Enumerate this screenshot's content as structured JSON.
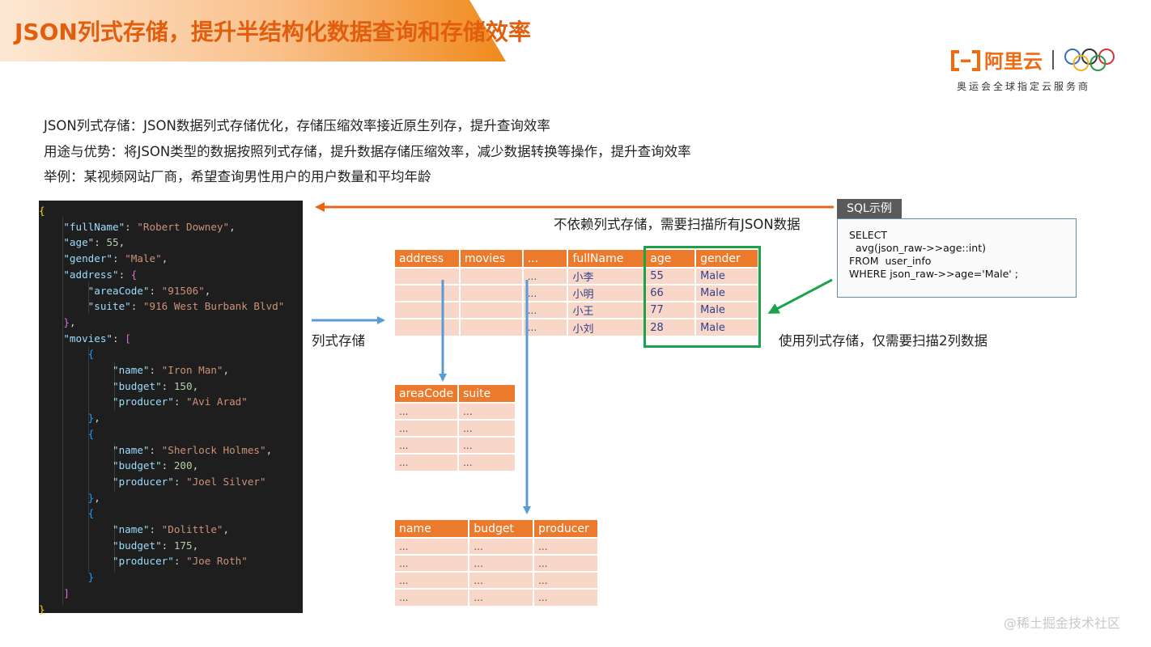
{
  "title": "JSON列式存储，提升半结构化数据查询和存储效率",
  "logo": {
    "brand": "阿里云",
    "subtitle": "奥运会全球指定云服务商",
    "brand_color": "#f26a10"
  },
  "description": [
    "JSON列式存储：JSON数据列式存储优化，存储压缩效率接近原生列存，提升查询效率",
    "用途与优势：将JSON类型的数据按照列式存储，提升数据存储压缩效率，减少数据转换等操作，提升查询效率",
    "举例：某视频网站厂商，希望查询男性用户的用户数量和平均年龄"
  ],
  "code": {
    "lines": [
      [
        [
          "b1",
          "{"
        ]
      ],
      [
        [
          "p",
          "    "
        ],
        [
          "k",
          "\"fullName\""
        ],
        [
          "p",
          ": "
        ],
        [
          "s",
          "\"Robert Downey\""
        ],
        [
          "p",
          ","
        ]
      ],
      [
        [
          "p",
          "    "
        ],
        [
          "k",
          "\"age\""
        ],
        [
          "p",
          ": "
        ],
        [
          "n",
          "55"
        ],
        [
          "p",
          ","
        ]
      ],
      [
        [
          "p",
          "    "
        ],
        [
          "k",
          "\"gender\""
        ],
        [
          "p",
          ": "
        ],
        [
          "s",
          "\"Male\""
        ],
        [
          "p",
          ","
        ]
      ],
      [
        [
          "p",
          "    "
        ],
        [
          "k",
          "\"address\""
        ],
        [
          "p",
          ": "
        ],
        [
          "b2",
          "{"
        ]
      ],
      [
        [
          "p",
          "        "
        ],
        [
          "k",
          "\"areaCode\""
        ],
        [
          "p",
          ": "
        ],
        [
          "s",
          "\"91506\""
        ],
        [
          "p",
          ","
        ]
      ],
      [
        [
          "p",
          "        "
        ],
        [
          "k",
          "\"suite\""
        ],
        [
          "p",
          ": "
        ],
        [
          "s",
          "\"916 West Burbank Blvd\""
        ]
      ],
      [
        [
          "p",
          "    "
        ],
        [
          "b2",
          "}"
        ],
        [
          "p",
          ","
        ]
      ],
      [
        [
          "p",
          "    "
        ],
        [
          "k",
          "\"movies\""
        ],
        [
          "p",
          ": "
        ],
        [
          "b2",
          "["
        ]
      ],
      [
        [
          "p",
          "        "
        ],
        [
          "b3",
          "{"
        ]
      ],
      [
        [
          "p",
          "            "
        ],
        [
          "k",
          "\"name\""
        ],
        [
          "p",
          ": "
        ],
        [
          "s",
          "\"Iron Man\""
        ],
        [
          "p",
          ","
        ]
      ],
      [
        [
          "p",
          "            "
        ],
        [
          "k",
          "\"budget\""
        ],
        [
          "p",
          ": "
        ],
        [
          "n",
          "150"
        ],
        [
          "p",
          ","
        ]
      ],
      [
        [
          "p",
          "            "
        ],
        [
          "k",
          "\"producer\""
        ],
        [
          "p",
          ": "
        ],
        [
          "s",
          "\"Avi Arad\""
        ]
      ],
      [
        [
          "p",
          "        "
        ],
        [
          "b3",
          "}"
        ],
        [
          "p",
          ","
        ]
      ],
      [
        [
          "p",
          "        "
        ],
        [
          "b3",
          "{"
        ]
      ],
      [
        [
          "p",
          "            "
        ],
        [
          "k",
          "\"name\""
        ],
        [
          "p",
          ": "
        ],
        [
          "s",
          "\"Sherlock Holmes\""
        ],
        [
          "p",
          ","
        ]
      ],
      [
        [
          "p",
          "            "
        ],
        [
          "k",
          "\"budget\""
        ],
        [
          "p",
          ": "
        ],
        [
          "n",
          "200"
        ],
        [
          "p",
          ","
        ]
      ],
      [
        [
          "p",
          "            "
        ],
        [
          "k",
          "\"producer\""
        ],
        [
          "p",
          ": "
        ],
        [
          "s",
          "\"Joel Silver\""
        ]
      ],
      [
        [
          "p",
          "        "
        ],
        [
          "b3",
          "}"
        ],
        [
          "p",
          ","
        ]
      ],
      [
        [
          "p",
          "        "
        ],
        [
          "b3",
          "{"
        ]
      ],
      [
        [
          "p",
          "            "
        ],
        [
          "k",
          "\"name\""
        ],
        [
          "p",
          ": "
        ],
        [
          "s",
          "\"Dolittle\""
        ],
        [
          "p",
          ","
        ]
      ],
      [
        [
          "p",
          "            "
        ],
        [
          "k",
          "\"budget\""
        ],
        [
          "p",
          ": "
        ],
        [
          "n",
          "175"
        ],
        [
          "p",
          ","
        ]
      ],
      [
        [
          "p",
          "            "
        ],
        [
          "k",
          "\"producer\""
        ],
        [
          "p",
          ": "
        ],
        [
          "s",
          "\"Joe Roth\""
        ]
      ],
      [
        [
          "p",
          "        "
        ],
        [
          "b3",
          "}"
        ]
      ],
      [
        [
          "p",
          "    "
        ],
        [
          "b2",
          "]"
        ]
      ],
      [
        [
          "b1",
          "}"
        ]
      ]
    ]
  },
  "main_table": {
    "headers": [
      "address",
      "movies",
      "...",
      "fullName",
      "age",
      "gender"
    ],
    "rows": [
      [
        "",
        "",
        "...",
        "小李",
        "55",
        "Male"
      ],
      [
        "",
        "",
        "...",
        "小明",
        "66",
        "Male"
      ],
      [
        "",
        "",
        "...",
        "小王",
        "77",
        "Male"
      ],
      [
        "",
        "",
        "...",
        "小刘",
        "28",
        "Male"
      ]
    ]
  },
  "address_table": {
    "headers": [
      "areaCode",
      "suite"
    ],
    "rows": [
      [
        "...",
        "..."
      ],
      [
        "...",
        "..."
      ],
      [
        "...",
        "..."
      ],
      [
        "...",
        "..."
      ]
    ]
  },
  "movies_table": {
    "headers": [
      "name",
      "budget",
      "producer"
    ],
    "rows": [
      [
        "...",
        "...",
        "..."
      ],
      [
        "...",
        "...",
        "..."
      ],
      [
        "...",
        "...",
        "..."
      ],
      [
        "...",
        "...",
        "..."
      ]
    ]
  },
  "labels": {
    "columnar": "列式存储",
    "full_scan": "不依赖列式存储，需要扫描所有JSON数据",
    "two_cols": "使用列式存储，仅需要扫描2列数据"
  },
  "sql": {
    "tab": "SQL示例",
    "lines": [
      "SELECT",
      "  avg(json_raw->>age::int)",
      "FROM  user_info",
      "WHERE json_raw->>age='Male' ;"
    ]
  },
  "watermark": "@稀土掘金技术社区",
  "colors": {
    "accent": "#ec7a2c",
    "highlight": "#1aa34a",
    "link": "#5b9bd5",
    "title": "#e05e0e"
  }
}
